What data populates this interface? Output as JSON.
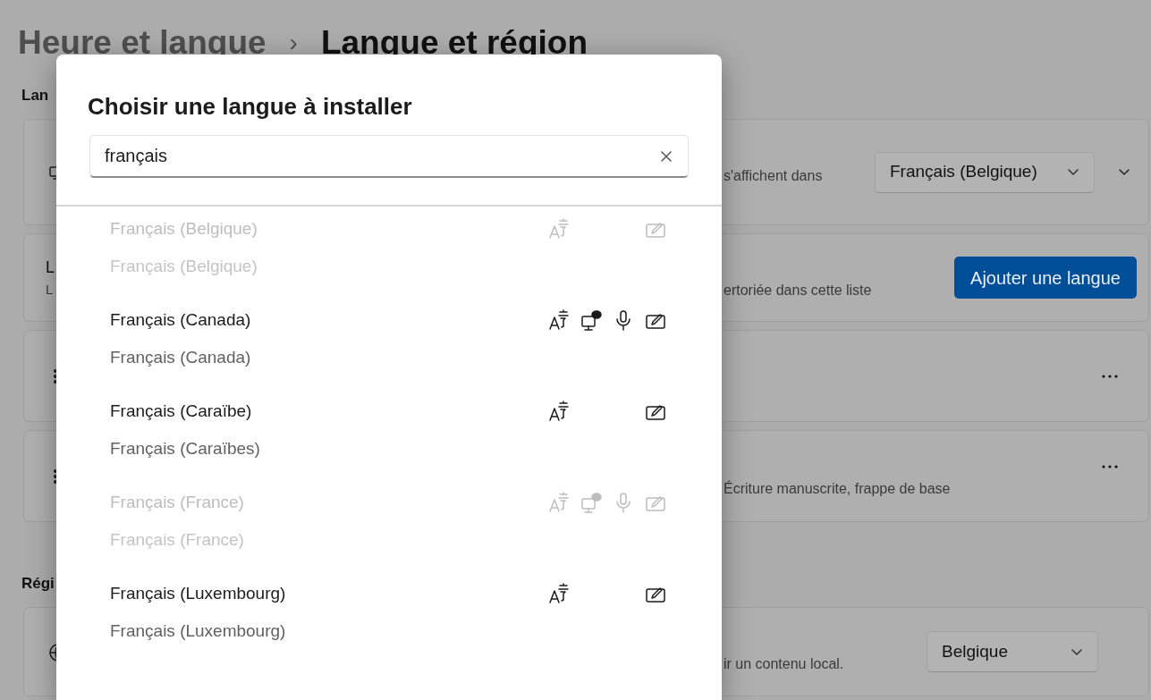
{
  "breadcrumb": {
    "parent": "Heure et langue",
    "separator": "›",
    "current": "Langue et région"
  },
  "sections": [
    {
      "heading": "Lan",
      "cards": [
        {
          "kind": "display_language",
          "description": "s'affichent dans",
          "dropdown": "Français (Belgique)"
        },
        {
          "kind": "add_language",
          "title": "L",
          "subtitle": "L",
          "description": "ertoriée dans cette liste",
          "button": "Ajouter une langue"
        },
        {
          "kind": "language_entry"
        },
        {
          "kind": "language_entry",
          "description": "Écriture manuscrite, frappe de base"
        }
      ]
    },
    {
      "heading": "Régi",
      "cards": [
        {
          "kind": "region",
          "description": "ir un contenu local.",
          "dropdown": "Belgique"
        }
      ]
    }
  ],
  "dialog": {
    "title": "Choisir une langue à installer",
    "search": {
      "value": "français"
    },
    "languages": [
      {
        "name": "Français (Belgique)",
        "native": "Français (Belgique)",
        "disabled": true,
        "features": {
          "language_pack": true,
          "text_to_speech": false,
          "speech_recognition": false,
          "handwriting": true
        }
      },
      {
        "name": "Français (Canada)",
        "native": "Français (Canada)",
        "disabled": false,
        "features": {
          "language_pack": true,
          "text_to_speech": true,
          "speech_recognition": true,
          "handwriting": true
        }
      },
      {
        "name": "Français (Caraïbe)",
        "native": "Français (Caraïbes)",
        "disabled": false,
        "features": {
          "language_pack": true,
          "text_to_speech": false,
          "speech_recognition": false,
          "handwriting": true
        }
      },
      {
        "name": "Français (France)",
        "native": "Français (France)",
        "disabled": true,
        "features": {
          "language_pack": true,
          "text_to_speech": true,
          "speech_recognition": true,
          "handwriting": true
        }
      },
      {
        "name": "Français (Luxembourg)",
        "native": "Français (Luxembourg)",
        "disabled": false,
        "features": {
          "language_pack": true,
          "text_to_speech": false,
          "speech_recognition": false,
          "handwriting": true
        }
      }
    ]
  }
}
